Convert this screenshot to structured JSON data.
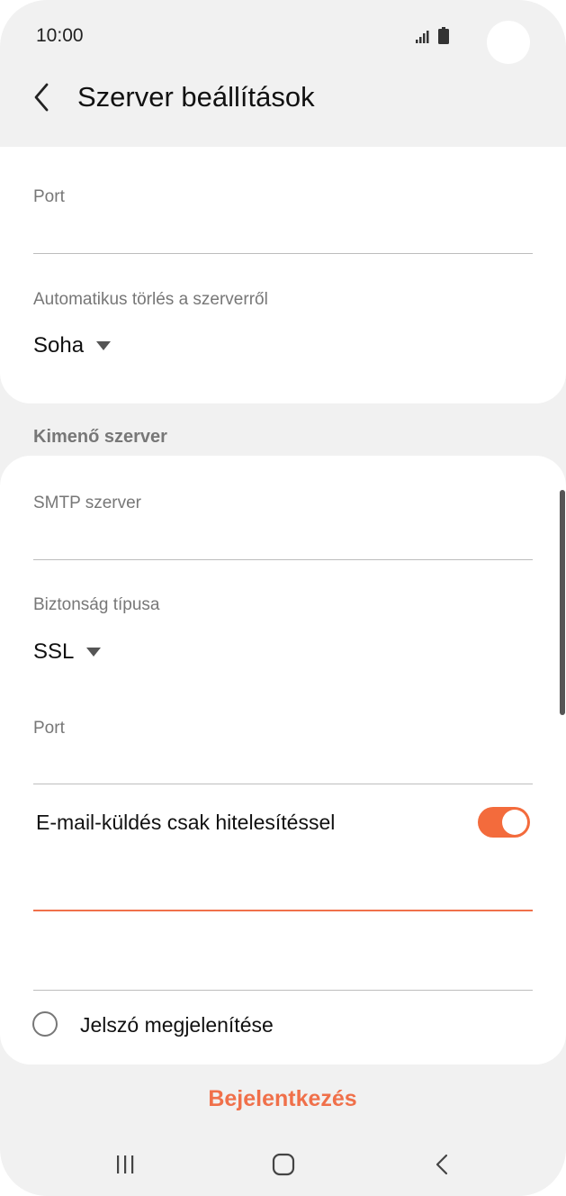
{
  "status_bar": {
    "time": "10:00"
  },
  "app_bar": {
    "title": "Szerver beállítások"
  },
  "incoming": {
    "port_label": "Port",
    "port_value": "",
    "auto_delete_label": "Automatikus törlés a szerverről",
    "auto_delete_value": "Soha"
  },
  "outgoing": {
    "section_title": "Kimenő szerver",
    "smtp_label": "SMTP szerver",
    "smtp_value": "",
    "security_label": "Biztonság típusa",
    "security_value": "SSL",
    "port_label": "Port",
    "port_value": "",
    "auth_toggle_label": "E-mail-küldés csak hitelesítéssel",
    "auth_toggle_on": true,
    "username_value": "",
    "password_value": "",
    "show_password_label": "Jelszó megjelenítése"
  },
  "actions": {
    "login_label": "Bejelentkezés"
  },
  "colors": {
    "accent": "#f0704a",
    "toggle_on": "#f36b3c",
    "background": "#f1f1f1",
    "card": "#ffffff"
  },
  "icons": {
    "back": "chevron-left-icon",
    "signal": "signal-icon",
    "battery": "battery-icon",
    "nav_recent": "recent-apps-icon",
    "nav_home": "home-icon",
    "nav_back": "nav-back-icon"
  }
}
